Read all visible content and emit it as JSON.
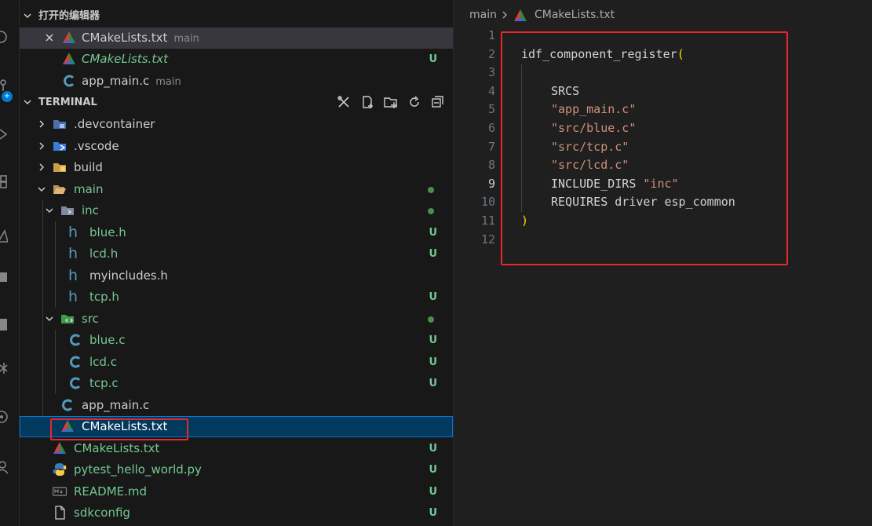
{
  "sidebar": {
    "open_editors": {
      "title": "打开的编辑器",
      "items": [
        {
          "name": "CMakeLists.txt",
          "desc": "main",
          "status": ""
        },
        {
          "name": "CMakeLists.txt",
          "desc": "",
          "status": "U"
        },
        {
          "name": "app_main.c",
          "desc": "main",
          "status": ""
        }
      ]
    },
    "explorer": {
      "title": "TERMINAL",
      "tree": [
        {
          "name": ".devcontainer",
          "status": ""
        },
        {
          "name": ".vscode",
          "status": ""
        },
        {
          "name": "build",
          "status": ""
        },
        {
          "name": "main",
          "status": "●"
        },
        {
          "name": "inc",
          "status": "●"
        },
        {
          "name": "blue.h",
          "status": "U"
        },
        {
          "name": "lcd.h",
          "status": "U"
        },
        {
          "name": "myincludes.h",
          "status": ""
        },
        {
          "name": "tcp.h",
          "status": "U"
        },
        {
          "name": "src",
          "status": "●"
        },
        {
          "name": "blue.c",
          "status": "U"
        },
        {
          "name": "lcd.c",
          "status": "U"
        },
        {
          "name": "tcp.c",
          "status": "U"
        },
        {
          "name": "app_main.c",
          "status": ""
        },
        {
          "name": "CMakeLists.txt",
          "status": ""
        },
        {
          "name": "CMakeLists.txt",
          "status": "U"
        },
        {
          "name": "pytest_hello_world.py",
          "status": "U"
        },
        {
          "name": "README.md",
          "status": "U"
        },
        {
          "name": "sdkconfig",
          "status": "U"
        }
      ]
    }
  },
  "editor": {
    "breadcrumb": [
      "main",
      "CMakeLists.txt"
    ],
    "line_numbers": [
      "1",
      "2",
      "3",
      "4",
      "5",
      "6",
      "7",
      "8",
      "9",
      "10",
      "11",
      "12"
    ],
    "lines": [
      {
        "func": "idf_component_register",
        "open": "("
      },
      {
        "kw": "SRCS"
      },
      {
        "str": "\"app_main.c\""
      },
      {
        "str": "\"src/blue.c\""
      },
      {
        "str": "\"src/tcp.c\""
      },
      {
        "str": "\"src/lcd.c\""
      },
      {
        "kw": "INCLUDE_DIRS",
        "str": "\"inc\""
      },
      {
        "kw": "REQUIRES driver esp_common"
      },
      {
        "close": ")"
      }
    ]
  },
  "colors": {
    "accent": "#0078d4",
    "highlight": "#e8262b",
    "untracked": "#73c991"
  }
}
